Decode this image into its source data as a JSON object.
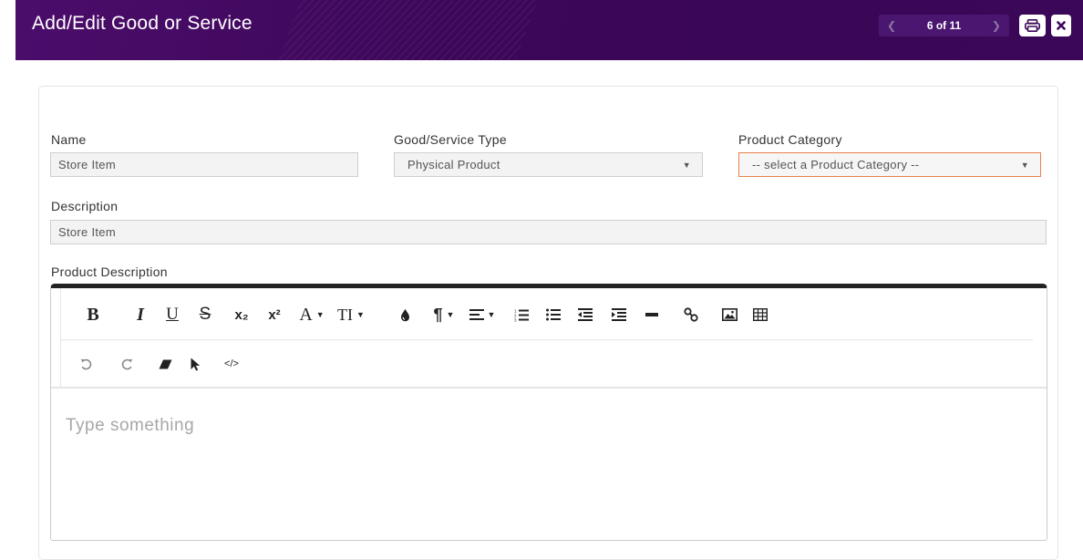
{
  "header": {
    "title": "Add/Edit Good or Service",
    "pager": {
      "text": "6 of 11",
      "prev_icon": "chevron-left-icon",
      "next_icon": "chevron-right-icon"
    },
    "print_icon": "print-icon",
    "close_icon": "close-icon"
  },
  "form": {
    "name": {
      "label": "Name",
      "value": "Store Item"
    },
    "type": {
      "label": "Good/Service Type",
      "value": "Physical Product"
    },
    "category": {
      "label": "Product Category",
      "value": "-- select a Product Category --"
    },
    "description": {
      "label": "Description",
      "value": "Store Item"
    },
    "product_description": {
      "label": "Product Description",
      "placeholder": "Type something"
    }
  },
  "toolbar": {
    "bold": "B",
    "italic": "I",
    "underline": "U",
    "strikethrough": "S",
    "subscript": "x₂",
    "superscript": "x²",
    "font_color": "A",
    "font_size": "TI",
    "paragraph": "¶"
  },
  "colors": {
    "header_bg": "#3d0759",
    "pager_bg": "#4a1670",
    "highlight_border": "#e8824d",
    "field_bg": "#f3f3f3",
    "editor_top_border": "#222222"
  }
}
